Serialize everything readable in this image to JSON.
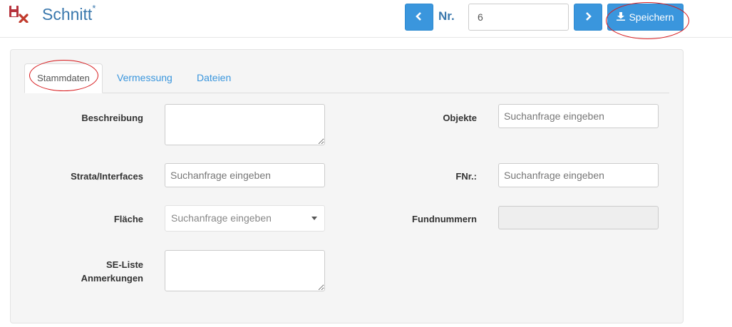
{
  "header": {
    "title": "Schnitt",
    "title_marker": "*",
    "nr_label": "Nr.",
    "nr_value": "6",
    "save_label": "Speichern",
    "prev_icon": "chevron-left-icon",
    "next_icon": "chevron-right-icon",
    "save_icon": "download-icon",
    "app_icon": "delete-file-icon"
  },
  "tabs": [
    {
      "label": "Stammdaten",
      "active": true
    },
    {
      "label": "Vermessung",
      "active": false
    },
    {
      "label": "Dateien",
      "active": false
    }
  ],
  "form": {
    "beschreibung": {
      "label": "Beschreibung",
      "value": ""
    },
    "objekte": {
      "label": "Objekte",
      "placeholder": "Suchanfrage eingeben"
    },
    "strata": {
      "label": "Strata/Interfaces",
      "placeholder": "Suchanfrage eingeben"
    },
    "fnr": {
      "label": "FNr.:",
      "placeholder": "Suchanfrage eingeben"
    },
    "flaeche": {
      "label": "Fläche",
      "placeholder": "Suchanfrage eingeben"
    },
    "fundnummern": {
      "label": "Fundnummern",
      "value": ""
    },
    "se_liste": {
      "label": "SE-Liste",
      "label2": "Anmerkungen",
      "value": ""
    }
  },
  "colors": {
    "accent": "#3a96dd",
    "title": "#3a78ad",
    "annotation": "#d7191c",
    "panel": "#f5f5f5"
  }
}
